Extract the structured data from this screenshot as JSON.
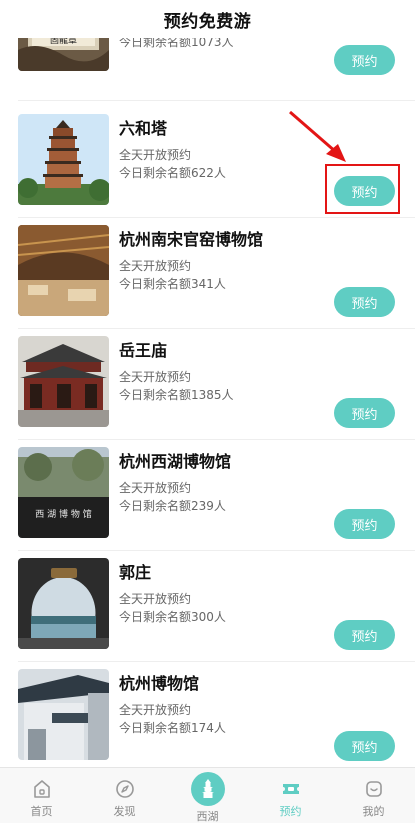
{
  "header": {
    "title": "预约免费游"
  },
  "items": [
    {
      "name": "",
      "open": "",
      "quota": "今日剩余名额1073人",
      "button": "预约",
      "img_text": "固龍章"
    },
    {
      "name": "六和塔",
      "open": "全天开放预约",
      "quota": "今日剩余名额622人",
      "button": "预约",
      "img_text": ""
    },
    {
      "name": "杭州南宋官窑博物馆",
      "open": "全天开放预约",
      "quota": "今日剩余名额341人",
      "button": "预约",
      "img_text": ""
    },
    {
      "name": "岳王庙",
      "open": "全天开放预约",
      "quota": "今日剩余名额1385人",
      "button": "预约",
      "img_text": ""
    },
    {
      "name": "杭州西湖博物馆",
      "open": "全天开放预约",
      "quota": "今日剩余名额239人",
      "button": "预约",
      "img_text": "西 湖 博 物 馆"
    },
    {
      "name": "郭庄",
      "open": "全天开放预约",
      "quota": "今日剩余名额300人",
      "button": "预约",
      "img_text": ""
    },
    {
      "name": "杭州博物馆",
      "open": "全天开放预约",
      "quota": "今日剩余名额174人",
      "button": "预约",
      "img_text": ""
    }
  ],
  "tabbar": {
    "tabs": [
      {
        "label": "首页",
        "icon": "home-icon"
      },
      {
        "label": "发现",
        "icon": "compass-icon"
      },
      {
        "label": "西湖",
        "icon": "pagoda-icon"
      },
      {
        "label": "预约",
        "icon": "ticket-icon"
      },
      {
        "label": "我的",
        "icon": "profile-icon"
      }
    ],
    "active": "预约"
  },
  "colors": {
    "accent": "#5fcdc3",
    "annotation": "#e31515"
  }
}
